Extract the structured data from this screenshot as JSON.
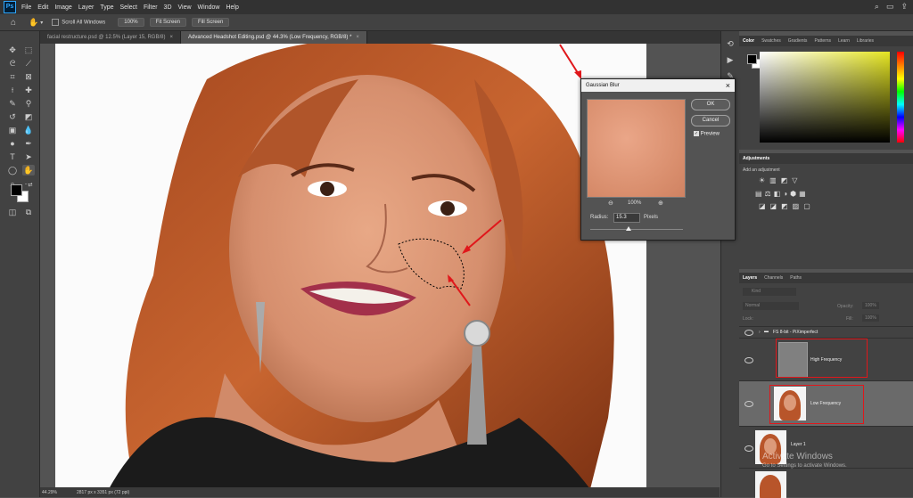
{
  "menu": {
    "app_icon": "Ps",
    "items": [
      "File",
      "Edit",
      "Image",
      "Layer",
      "Type",
      "Select",
      "Filter",
      "3D",
      "View",
      "Window",
      "Help"
    ]
  },
  "options": {
    "scroll_all_windows": "Scroll All Windows",
    "zoom": "100%",
    "fit_screen": "Fit Screen",
    "fill_screen": "Fill Screen"
  },
  "tabs": [
    {
      "label": "facial restructure.psd @ 12.5% (Layer 15, RGB/8)"
    },
    {
      "label": "Advanced Headshot Editing.psd @ 44.3% (Low Frequency, RGB/8) *"
    }
  ],
  "status": {
    "zoom": "44.29%",
    "doc_size": "2817 px x 3351 px (72 ppi)"
  },
  "color_panel": {
    "tabs": [
      "Color",
      "Swatches",
      "Gradients",
      "Patterns",
      "Learn",
      "Libraries"
    ],
    "hue_color": "#e5e522"
  },
  "adjustments": {
    "title": "Adjustments",
    "add_label": "Add an adjustment"
  },
  "layers_panel": {
    "tabs": [
      "Layers",
      "Channels",
      "Paths"
    ],
    "search_placeholder": "Kind",
    "blend_mode": "Normal",
    "opacity_label": "Opacity:",
    "opacity_value": "100%",
    "lock_label": "Lock:",
    "fill_label": "Fill:",
    "fill_value": "100%",
    "group_name": "FS 8-bit - PiXimperfect",
    "layers": [
      "High Frequency",
      "Low Frequency",
      "Layer 1"
    ]
  },
  "watermark": {
    "title": "Activate Windows",
    "subtitle": "Go to Settings to activate Windows."
  },
  "gaussian_blur": {
    "title": "Gaussian Blur",
    "ok": "OK",
    "cancel": "Cancel",
    "preview_label": "Preview",
    "zoom": "100%",
    "radius_label": "Radius:",
    "radius_value": "15.3",
    "unit": "Pixels"
  },
  "colors": {
    "accent_red": "#e0171b",
    "selected_layer": "#6a6a6a"
  }
}
